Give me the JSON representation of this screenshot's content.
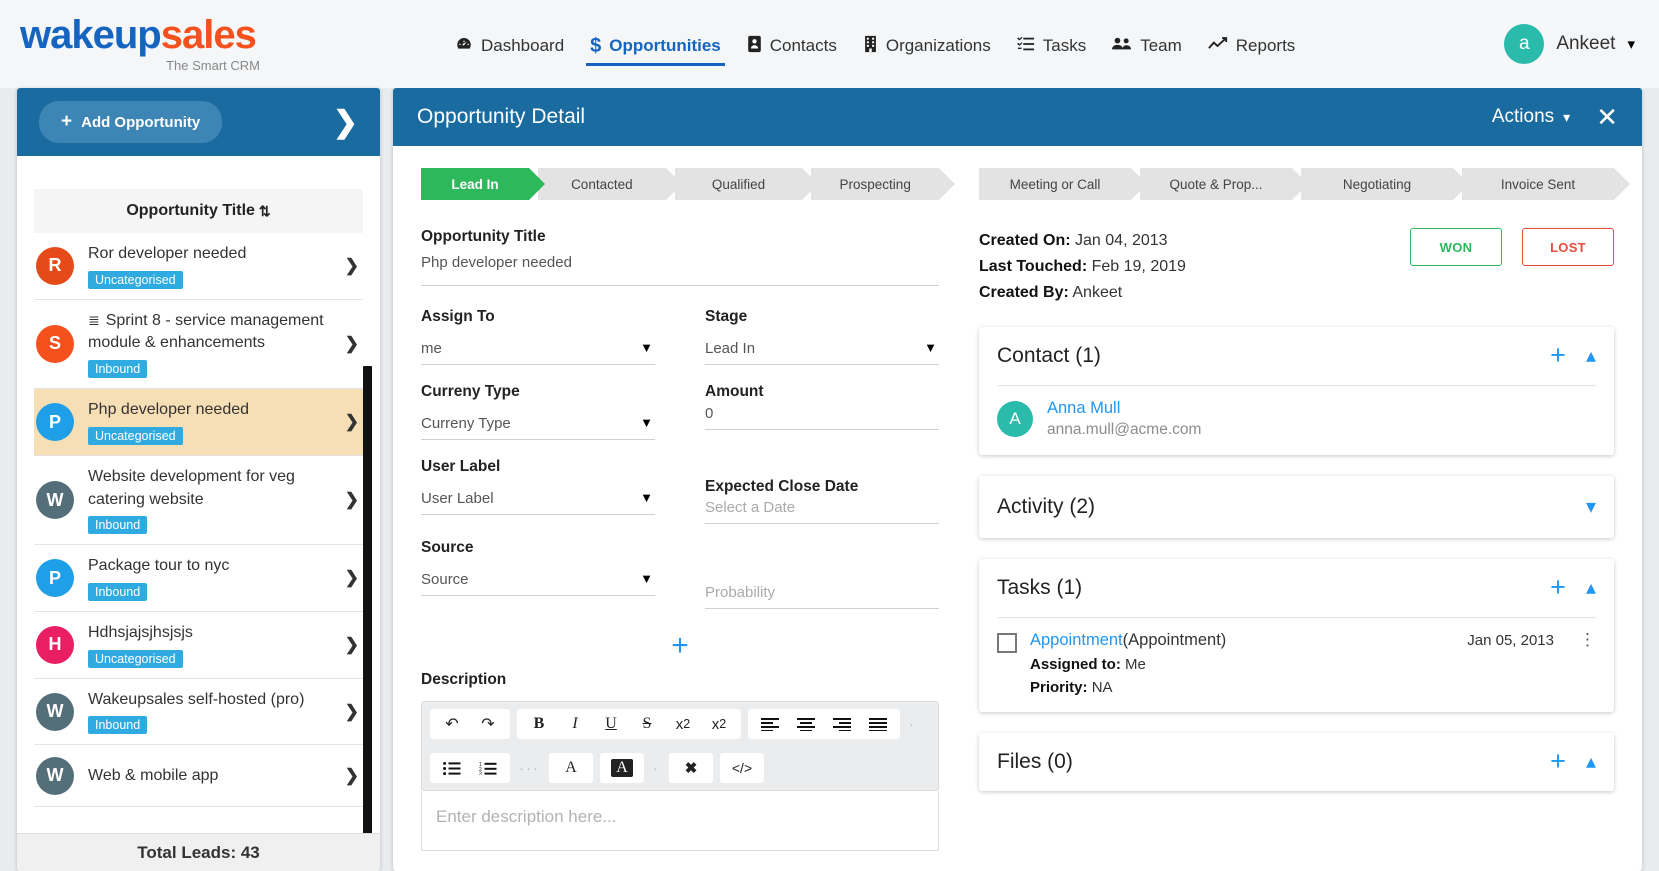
{
  "brand": {
    "name_part1": "wakeup",
    "name_part2": "sales",
    "tagline": "The Smart CRM"
  },
  "nav": {
    "items": [
      {
        "label": "Dashboard",
        "icon": "⑩",
        "glyph": "◔",
        "active": false
      },
      {
        "label": "Opportunities",
        "glyph": "$",
        "active": true
      },
      {
        "label": "Contacts",
        "glyph": "☰",
        "active": false
      },
      {
        "label": "Organizations",
        "glyph": "☷",
        "active": false
      },
      {
        "label": "Tasks",
        "glyph": "≣",
        "active": false
      },
      {
        "label": "Team",
        "glyph": "☺",
        "active": false
      },
      {
        "label": "Reports",
        "glyph": "↗",
        "active": false
      }
    ]
  },
  "user": {
    "initial": "a",
    "name": "Ankeet",
    "caret": "▾",
    "avatar_color": "#2bbbad"
  },
  "sidebar": {
    "add_button": "Add Opportunity",
    "add_icon": "+",
    "collapse_icon": "❯",
    "sort_header": "Opportunity Title",
    "sort_icon": "↕",
    "footer": "Total Leads: 43",
    "items": [
      {
        "initial": "R",
        "color": "#e64a19",
        "title": "Ror developer needed",
        "badge": "Uncategorised",
        "selected": false,
        "has_list_icon": false
      },
      {
        "initial": "S",
        "color": "#f4511e",
        "title": "Sprint 8 - service management module & enhancements",
        "badge": "Inbound",
        "selected": false,
        "has_list_icon": true
      },
      {
        "initial": "P",
        "color": "#1e9fe8",
        "title": "Php developer needed",
        "badge": "Uncategorised",
        "selected": true,
        "has_list_icon": false
      },
      {
        "initial": "W",
        "color": "#546e7a",
        "title": "Website development for veg catering website",
        "badge": "Inbound",
        "selected": false,
        "has_list_icon": false
      },
      {
        "initial": "P",
        "color": "#1e9fe8",
        "title": "Package tour to nyc",
        "badge": "Inbound",
        "selected": false,
        "has_list_icon": false
      },
      {
        "initial": "H",
        "color": "#e91e63",
        "title": "Hdhsjajsjhsjsjs",
        "badge": "Uncategorised",
        "selected": false,
        "has_list_icon": false
      },
      {
        "initial": "W",
        "color": "#546e7a",
        "title": "Wakeupsales self-hosted (pro)",
        "badge": "Inbound",
        "selected": false,
        "has_list_icon": false
      },
      {
        "initial": "W",
        "color": "#546e7a",
        "title": "Web & mobile app",
        "badge": "",
        "selected": false,
        "has_list_icon": false
      }
    ]
  },
  "detail": {
    "header_title": "Opportunity Detail",
    "actions_label": "Actions",
    "actions_caret": "▾",
    "close_icon": "✕",
    "pipeline": [
      {
        "label": "Lead In",
        "active": true
      },
      {
        "label": "Contacted",
        "active": false
      },
      {
        "label": "Qualified",
        "active": false
      },
      {
        "label": "Prospecting",
        "active": false
      },
      {
        "label": "Meeting or Call",
        "active": false
      },
      {
        "label": "Quote & Prop...",
        "active": false
      },
      {
        "label": "Negotiating",
        "active": false
      },
      {
        "label": "Invoice Sent",
        "active": false
      }
    ],
    "form": {
      "title_label": "Opportunity Title",
      "title_value": "Php developer needed",
      "assign_label": "Assign To",
      "assign_value": "me",
      "stage_label": "Stage",
      "stage_value": "Lead In",
      "currency_label": "Curreny Type",
      "currency_value": "Curreny Type",
      "amount_label": "Amount",
      "amount_value": "0",
      "userlabel_label": "User Label",
      "userlabel_value": "User Label",
      "close_date_label": "Expected Close Date",
      "close_date_value": "Select a Date",
      "source_label": "Source",
      "source_value": "Source",
      "probability_placeholder": "Probability",
      "caret": "▼",
      "add_field_icon": "+"
    },
    "description": {
      "label": "Description",
      "placeholder": "Enter description here...",
      "toolbar_row1": [
        {
          "glyph": "↶",
          "name": "undo-icon"
        },
        {
          "glyph": "↷",
          "name": "redo-icon"
        },
        {
          "glyph": "B",
          "name": "bold-icon"
        },
        {
          "glyph": "I",
          "name": "italic-icon"
        },
        {
          "glyph": "U",
          "name": "underline-icon"
        },
        {
          "glyph": "S",
          "name": "strikethrough-icon"
        },
        {
          "glyph": "x₂",
          "name": "subscript-icon"
        },
        {
          "glyph": "x²",
          "name": "superscript-icon"
        },
        {
          "glyph": "≡",
          "name": "align-left-icon"
        },
        {
          "glyph": "≡",
          "name": "align-center-icon"
        },
        {
          "glyph": "≡",
          "name": "align-right-icon"
        },
        {
          "glyph": "≡",
          "name": "align-justify-icon"
        }
      ],
      "toolbar_row2": [
        {
          "glyph": "≣",
          "name": "bullet-list-icon"
        },
        {
          "glyph": "≣",
          "name": "numbered-list-icon"
        },
        {
          "glyph": "A",
          "name": "text-color-icon"
        },
        {
          "glyph": "A",
          "name": "highlight-color-icon"
        },
        {
          "glyph": "✖",
          "name": "clear-format-icon"
        },
        {
          "glyph": "</>",
          "name": "code-view-icon"
        }
      ]
    },
    "meta": {
      "created_on_label": "Created On:",
      "created_on_value": "Jan 04, 2013",
      "last_touched_label": "Last Touched:",
      "last_touched_value": "Feb 19, 2019",
      "created_by_label": "Created By:",
      "created_by_value": "Ankeet",
      "won_button": "WON",
      "lost_button": "LOST"
    },
    "contact_card": {
      "title": "Contact (1)",
      "plus": "+",
      "chevron": "⌃",
      "contacts": [
        {
          "initial": "A",
          "name": "Anna Mull",
          "email": "anna.mull@acme.com"
        }
      ]
    },
    "activity_card": {
      "title": "Activity (2)",
      "chevron": "⌄"
    },
    "tasks_card": {
      "title": "Tasks (1)",
      "plus": "+",
      "chevron": "⌃",
      "tasks": [
        {
          "link_text": "Appointment",
          "type_text": "(Appointment)",
          "assigned_label": "Assigned to:",
          "assigned_value": "Me",
          "priority_label": "Priority:",
          "priority_value": "NA",
          "date": "Jan 05, 2013",
          "kebab": "⋮"
        }
      ]
    },
    "files_card": {
      "title": "Files (0)",
      "plus": "+",
      "chevron": "⌃"
    }
  },
  "colors": {
    "brand_blue": "#1565c0",
    "brand_orange": "#f4511e",
    "header_blue": "#1a6ba0",
    "accent_blue": "#2196f3",
    "green": "#2eb85c",
    "red": "#e74c3c",
    "teal": "#2bbbad"
  }
}
